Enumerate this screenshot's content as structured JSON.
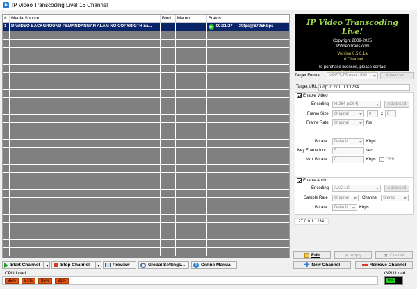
{
  "window": {
    "title": "IP Video Transcoding Live! 16 Channel"
  },
  "grid": {
    "columns": [
      "#",
      "Media Source",
      "Bind",
      "Memo",
      "Status"
    ],
    "rows": [
      {
        "num": "1",
        "source": "D:\\VIDEO BACKGROUND PEMANDANGAN ALAM NO COPYRIGTH na...",
        "bind": "",
        "memo": "",
        "time": "00:01:27",
        "rate": "30fps@6795Kbps"
      }
    ]
  },
  "banner": {
    "brand": "IP Video Transcoding Live!",
    "copyright": "Copyright 2009-2025",
    "site": "IPVideoTrans.com",
    "version": "Version 6.5.6.1a",
    "channels": "16 Channel",
    "purchase": "To purchase licenses, please contact",
    "email": "sales@ipvideotrans.com"
  },
  "settings": {
    "target_format_label": "Target Format",
    "target_format_value": "MPEG-TS over UDP",
    "advanced_label": "Advanced...",
    "target_url_label": "Target URL",
    "target_url_value": "udp://127.0.0.1:1234",
    "enable_video_label": "Enable Video",
    "encoding_label": "Encoding",
    "video_encoding_value": "H.264 (x264)",
    "video_advanced_label": "Advanced",
    "frame_size_label": "Frame Size",
    "frame_size_value": "Original",
    "frame_w": "0",
    "frame_x": "x",
    "frame_h": "0",
    "frame_rate_label": "Frame Rate",
    "frame_rate_value": "Original",
    "fps_unit": "fps",
    "bitrate_label": "Bitrate",
    "video_bitrate_value": "Default",
    "kbps_unit": "Kbps",
    "keyframe_label": "Key Frame Intv.",
    "keyframe_value": "5",
    "sec_unit": "sec",
    "mux_bitrate_label": "Mux Bitrate",
    "mux_bitrate_value": "0",
    "cbr_label": "CBR",
    "enable_audio_label": "Enable Audio",
    "audio_encoding_value": "AAC-LC",
    "audio_advanced_label": "Advanced",
    "sample_rate_label": "Sample Rate",
    "sample_rate_value": "Original",
    "channel_label": "Channel",
    "channel_value": "Stereo",
    "audio_bitrate_value": "Default",
    "output_address": "127.0.0.1:1234"
  },
  "actions": {
    "edit": "Edit",
    "apply": "Apply",
    "cancel": "Cancel",
    "new_channel": "New Channel",
    "remove_channel": "Remove Channel"
  },
  "toolbar": {
    "start_channel": "Start Channel",
    "stop_channel": "Stop Channel",
    "preview": "Preview",
    "global_settings": "Global Settings...",
    "online_manual": "Online Manual"
  },
  "load": {
    "cpu_label": "CPU Load",
    "cpu_values": [
      "85%",
      "81%",
      "85%",
      "81%"
    ],
    "gpu_label": "GPU Load",
    "gpu_value": "9%",
    "gpu_fraction": 0.09
  },
  "colors": {
    "selected_row": "#0a246a",
    "cpu_bar": "#e8530e",
    "gpu_bar": "#19d219",
    "brand": "#9fd64a"
  }
}
